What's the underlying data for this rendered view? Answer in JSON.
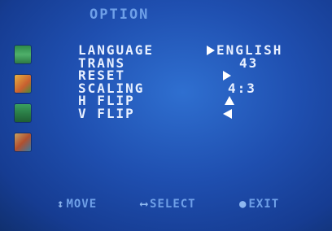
{
  "menu": {
    "title": "OPTION",
    "side_icons": [
      {
        "name": "picture-menu-icon"
      },
      {
        "name": "color-menu-icon"
      },
      {
        "name": "osd-menu-icon"
      },
      {
        "name": "option-menu-icon"
      }
    ],
    "items": [
      {
        "label": "LANGUAGE",
        "value": "ENGLISH"
      },
      {
        "label": "TRANS",
        "value": "43"
      },
      {
        "label": "RESET",
        "value": ""
      },
      {
        "label": "SCALING",
        "value": "4:3"
      },
      {
        "label": "H FLIP",
        "value": ""
      },
      {
        "label": "V FLIP",
        "value": ""
      }
    ]
  },
  "footer": {
    "move_glyph": "↕",
    "move_label": "MOVE",
    "select_glyph": "⟷",
    "select_label": "SELECT",
    "exit_glyph": "●",
    "exit_label": "EXIT"
  },
  "colors": {
    "background": "#1f4fb0",
    "text": "#e8f0ff",
    "title": "#6fa0e8"
  }
}
